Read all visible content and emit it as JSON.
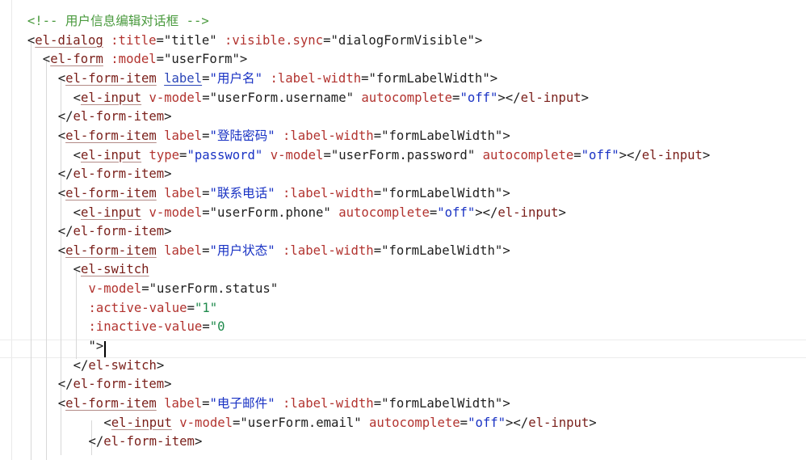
{
  "editor": {
    "lines": [
      {
        "indent": 2,
        "tokens": [
          {
            "t": "<!-- 用户信息编辑对话框 -->",
            "c": "comment"
          }
        ]
      },
      {
        "indent": 2,
        "tokens": [
          {
            "t": "<",
            "c": "punct"
          },
          {
            "t": "el-dialog",
            "c": "tag"
          },
          {
            "t": " ",
            "c": "punct"
          },
          {
            "t": ":title",
            "c": "attr"
          },
          {
            "t": "=",
            "c": "punct"
          },
          {
            "t": "\"title\"",
            "c": "str-dark"
          },
          {
            "t": " ",
            "c": "punct"
          },
          {
            "t": ":visible.sync",
            "c": "attr"
          },
          {
            "t": "=",
            "c": "punct"
          },
          {
            "t": "\"dialogFormVisible\"",
            "c": "str-dark"
          },
          {
            "t": ">",
            "c": "punct"
          }
        ]
      },
      {
        "indent": 4,
        "tokens": [
          {
            "t": "<",
            "c": "punct"
          },
          {
            "t": "el-form",
            "c": "tag"
          },
          {
            "t": " ",
            "c": "punct"
          },
          {
            "t": ":model",
            "c": "attr"
          },
          {
            "t": "=",
            "c": "punct"
          },
          {
            "t": "\"userForm\"",
            "c": "str-dark"
          },
          {
            "t": ">",
            "c": "punct"
          }
        ]
      },
      {
        "indent": 6,
        "tokens": [
          {
            "t": "<",
            "c": "punct"
          },
          {
            "t": "el-form-item",
            "c": "tag"
          },
          {
            "t": " ",
            "c": "punct"
          },
          {
            "t": "label",
            "c": "attr-ul"
          },
          {
            "t": "=",
            "c": "punct"
          },
          {
            "t": "\"用户名\"",
            "c": "str-blue"
          },
          {
            "t": " ",
            "c": "punct"
          },
          {
            "t": ":label-width",
            "c": "attr"
          },
          {
            "t": "=",
            "c": "punct"
          },
          {
            "t": "\"formLabelWidth\"",
            "c": "str-dark"
          },
          {
            "t": ">",
            "c": "punct"
          }
        ]
      },
      {
        "indent": 8,
        "tokens": [
          {
            "t": "<",
            "c": "punct"
          },
          {
            "t": "el-input",
            "c": "tag"
          },
          {
            "t": " ",
            "c": "punct"
          },
          {
            "t": "v-model",
            "c": "attr"
          },
          {
            "t": "=",
            "c": "punct"
          },
          {
            "t": "\"userForm.username\"",
            "c": "str-dark"
          },
          {
            "t": " ",
            "c": "punct"
          },
          {
            "t": "autocomplete",
            "c": "attr"
          },
          {
            "t": "=",
            "c": "punct"
          },
          {
            "t": "\"off\"",
            "c": "str-blue"
          },
          {
            "t": "></",
            "c": "punct"
          },
          {
            "t": "el-input",
            "c": "tagplain"
          },
          {
            "t": ">",
            "c": "punct"
          }
        ]
      },
      {
        "indent": 6,
        "tokens": [
          {
            "t": "</",
            "c": "punct"
          },
          {
            "t": "el-form-item",
            "c": "tagplain"
          },
          {
            "t": ">",
            "c": "punct"
          }
        ]
      },
      {
        "indent": 6,
        "tokens": [
          {
            "t": "<",
            "c": "punct"
          },
          {
            "t": "el-form-item",
            "c": "tag"
          },
          {
            "t": " ",
            "c": "punct"
          },
          {
            "t": "label",
            "c": "attr"
          },
          {
            "t": "=",
            "c": "punct"
          },
          {
            "t": "\"登陆密码\"",
            "c": "str-blue"
          },
          {
            "t": " ",
            "c": "punct"
          },
          {
            "t": ":label-width",
            "c": "attr"
          },
          {
            "t": "=",
            "c": "punct"
          },
          {
            "t": "\"formLabelWidth\"",
            "c": "str-dark"
          },
          {
            "t": ">",
            "c": "punct"
          }
        ]
      },
      {
        "indent": 8,
        "tokens": [
          {
            "t": "<",
            "c": "punct"
          },
          {
            "t": "el-input",
            "c": "tag"
          },
          {
            "t": " ",
            "c": "punct"
          },
          {
            "t": "type",
            "c": "attr"
          },
          {
            "t": "=",
            "c": "punct"
          },
          {
            "t": "\"password\"",
            "c": "str-blue"
          },
          {
            "t": " ",
            "c": "punct"
          },
          {
            "t": "v-model",
            "c": "attr"
          },
          {
            "t": "=",
            "c": "punct"
          },
          {
            "t": "\"userForm.password\"",
            "c": "str-dark"
          },
          {
            "t": " ",
            "c": "punct"
          },
          {
            "t": "autocomplete",
            "c": "attr"
          },
          {
            "t": "=",
            "c": "punct"
          },
          {
            "t": "\"off\"",
            "c": "str-blue"
          },
          {
            "t": "></",
            "c": "punct"
          },
          {
            "t": "el-input",
            "c": "tagplain"
          },
          {
            "t": ">",
            "c": "punct"
          }
        ]
      },
      {
        "indent": 6,
        "tokens": [
          {
            "t": "</",
            "c": "punct"
          },
          {
            "t": "el-form-item",
            "c": "tagplain"
          },
          {
            "t": ">",
            "c": "punct"
          }
        ]
      },
      {
        "indent": 6,
        "tokens": [
          {
            "t": "<",
            "c": "punct"
          },
          {
            "t": "el-form-item",
            "c": "tag"
          },
          {
            "t": " ",
            "c": "punct"
          },
          {
            "t": "label",
            "c": "attr"
          },
          {
            "t": "=",
            "c": "punct"
          },
          {
            "t": "\"联系电话\"",
            "c": "str-blue"
          },
          {
            "t": " ",
            "c": "punct"
          },
          {
            "t": ":label-width",
            "c": "attr"
          },
          {
            "t": "=",
            "c": "punct"
          },
          {
            "t": "\"formLabelWidth\"",
            "c": "str-dark"
          },
          {
            "t": ">",
            "c": "punct"
          }
        ]
      },
      {
        "indent": 8,
        "tokens": [
          {
            "t": "<",
            "c": "punct"
          },
          {
            "t": "el-input",
            "c": "tag"
          },
          {
            "t": " ",
            "c": "punct"
          },
          {
            "t": "v-model",
            "c": "attr"
          },
          {
            "t": "=",
            "c": "punct"
          },
          {
            "t": "\"userForm.phone\"",
            "c": "str-dark"
          },
          {
            "t": " ",
            "c": "punct"
          },
          {
            "t": "autocomplete",
            "c": "attr"
          },
          {
            "t": "=",
            "c": "punct"
          },
          {
            "t": "\"off\"",
            "c": "str-blue"
          },
          {
            "t": "></",
            "c": "punct"
          },
          {
            "t": "el-input",
            "c": "tagplain"
          },
          {
            "t": ">",
            "c": "punct"
          }
        ]
      },
      {
        "indent": 6,
        "tokens": [
          {
            "t": "</",
            "c": "punct"
          },
          {
            "t": "el-form-item",
            "c": "tagplain"
          },
          {
            "t": ">",
            "c": "punct"
          }
        ]
      },
      {
        "indent": 6,
        "tokens": [
          {
            "t": "<",
            "c": "punct"
          },
          {
            "t": "el-form-item",
            "c": "tag"
          },
          {
            "t": " ",
            "c": "punct"
          },
          {
            "t": "label",
            "c": "attr"
          },
          {
            "t": "=",
            "c": "punct"
          },
          {
            "t": "\"用户状态\"",
            "c": "str-blue"
          },
          {
            "t": " ",
            "c": "punct"
          },
          {
            "t": ":label-width",
            "c": "attr"
          },
          {
            "t": "=",
            "c": "punct"
          },
          {
            "t": "\"formLabelWidth\"",
            "c": "str-dark"
          },
          {
            "t": ">",
            "c": "punct"
          }
        ]
      },
      {
        "indent": 8,
        "tokens": [
          {
            "t": "<",
            "c": "punct"
          },
          {
            "t": "el-switch",
            "c": "tag"
          }
        ]
      },
      {
        "indent": 10,
        "tokens": [
          {
            "t": "v-model",
            "c": "attr"
          },
          {
            "t": "=",
            "c": "punct"
          },
          {
            "t": "\"userForm.status\"",
            "c": "str-dark"
          }
        ]
      },
      {
        "indent": 10,
        "tokens": [
          {
            "t": ":active-value",
            "c": "attr"
          },
          {
            "t": "=",
            "c": "punct"
          },
          {
            "t": "\"1\"",
            "c": "num"
          }
        ]
      },
      {
        "indent": 10,
        "tokens": [
          {
            "t": ":inactive-value",
            "c": "attr"
          },
          {
            "t": "=",
            "c": "punct"
          },
          {
            "t": "\"0",
            "c": "num"
          }
        ]
      },
      {
        "indent": 10,
        "tokens": [
          {
            "t": "\">",
            "c": "punct"
          }
        ]
      },
      {
        "indent": 8,
        "tokens": [
          {
            "t": "</",
            "c": "punct"
          },
          {
            "t": "el-switch",
            "c": "tagplain"
          },
          {
            "t": ">",
            "c": "punct"
          }
        ]
      },
      {
        "indent": 6,
        "tokens": [
          {
            "t": "</",
            "c": "punct"
          },
          {
            "t": "el-form-item",
            "c": "tagplain"
          },
          {
            "t": ">",
            "c": "punct"
          }
        ]
      },
      {
        "indent": 6,
        "tokens": [
          {
            "t": "<",
            "c": "punct"
          },
          {
            "t": "el-form-item",
            "c": "tag"
          },
          {
            "t": " ",
            "c": "punct"
          },
          {
            "t": "label",
            "c": "attr"
          },
          {
            "t": "=",
            "c": "punct"
          },
          {
            "t": "\"电子邮件\"",
            "c": "str-blue"
          },
          {
            "t": " ",
            "c": "punct"
          },
          {
            "t": ":label-width",
            "c": "attr"
          },
          {
            "t": "=",
            "c": "punct"
          },
          {
            "t": "\"formLabelWidth\"",
            "c": "str-dark"
          },
          {
            "t": ">",
            "c": "punct"
          }
        ]
      },
      {
        "indent": 12,
        "tokens": [
          {
            "t": "<",
            "c": "punct"
          },
          {
            "t": "el-input",
            "c": "tag"
          },
          {
            "t": " ",
            "c": "punct"
          },
          {
            "t": "v-model",
            "c": "attr"
          },
          {
            "t": "=",
            "c": "punct"
          },
          {
            "t": "\"userForm.email\"",
            "c": "str-dark"
          },
          {
            "t": " ",
            "c": "punct"
          },
          {
            "t": "autocomplete",
            "c": "attr"
          },
          {
            "t": "=",
            "c": "punct"
          },
          {
            "t": "\"off\"",
            "c": "str-blue"
          },
          {
            "t": "></",
            "c": "punct"
          },
          {
            "t": "el-input",
            "c": "tagplain"
          },
          {
            "t": ">",
            "c": "punct"
          }
        ]
      },
      {
        "indent": 10,
        "tokens": [
          {
            "t": "</",
            "c": "punct"
          },
          {
            "t": "el-form-item",
            "c": "tagplain"
          },
          {
            "t": ">",
            "c": "punct"
          }
        ]
      }
    ]
  }
}
